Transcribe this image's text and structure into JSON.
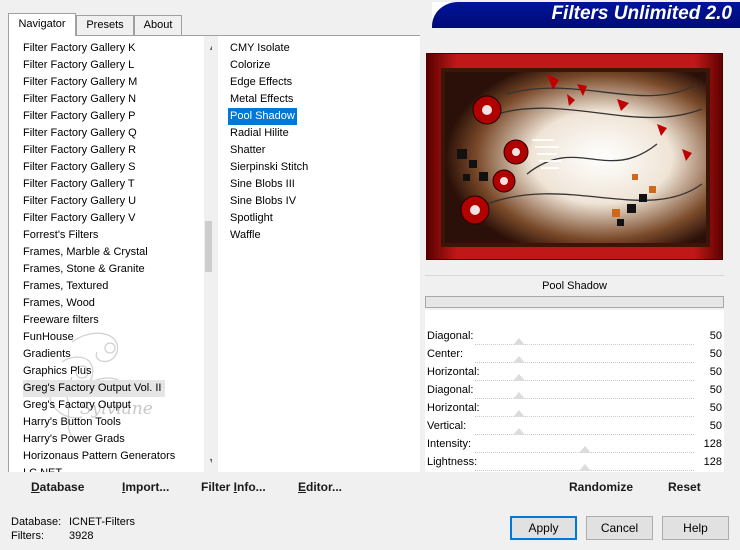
{
  "tabs": [
    "Navigator",
    "Presets",
    "About"
  ],
  "banner": {
    "title": "Filters Unlimited 2.0"
  },
  "categories": [
    "Filter Factory Gallery K",
    "Filter Factory Gallery L",
    "Filter Factory Gallery M",
    "Filter Factory Gallery N",
    "Filter Factory Gallery P",
    "Filter Factory Gallery Q",
    "Filter Factory Gallery R",
    "Filter Factory Gallery S",
    "Filter Factory Gallery T",
    "Filter Factory Gallery U",
    "Filter Factory Gallery V",
    "Forrest's Filters",
    "Frames, Marble & Crystal",
    "Frames, Stone & Granite",
    "Frames, Textured",
    "Frames, Wood",
    "Freeware filters",
    "FunHouse",
    "Gradients",
    "Graphics Plus",
    "Greg's Factory Output Vol. II",
    "Greg's Factory Output",
    "Harry's Button Tools",
    "Harry's Power Grads",
    "Horizonaus Pattern Generators",
    "I.C.NET"
  ],
  "filters": [
    "CMY Isolate",
    "Colorize",
    "Edge Effects",
    "Metal Effects",
    "Pool Shadow",
    "Radial Hilite",
    "Shatter",
    "Sierpinski Stitch",
    "Sine Blobs III",
    "Sine Blobs IV",
    "Spotlight",
    "Waffle"
  ],
  "watermark": {
    "text": "Sylviane"
  },
  "params": {
    "title": "Pool Shadow",
    "rows": [
      {
        "label": "Diagonal:",
        "value": "50",
        "level": 0.2
      },
      {
        "label": "Center:",
        "value": "50",
        "level": 0.2
      },
      {
        "label": "Horizontal:",
        "value": "50",
        "level": 0.2
      },
      {
        "label": "Diagonal:",
        "value": "50",
        "level": 0.2
      },
      {
        "label": "Horizontal:",
        "value": "50",
        "level": 0.2
      },
      {
        "label": "Vertical:",
        "value": "50",
        "level": 0.2
      },
      {
        "label": "Intensity:",
        "value": "128",
        "level": 0.5
      },
      {
        "label": "Lightness:",
        "value": "128",
        "level": 0.5
      }
    ]
  },
  "left_buttons": {
    "database": {
      "u": "D",
      "rest": "atabase"
    },
    "import": {
      "pre": "",
      "u": "I",
      "rest": "mport..."
    },
    "filter_info": {
      "pre": "Filter ",
      "u": "I",
      "rest": "nfo..."
    },
    "editor": {
      "u": "E",
      "rest": "ditor..."
    }
  },
  "right_buttons": {
    "randomize": "Randomize",
    "reset": "Reset"
  },
  "status": {
    "database_label": "Database:",
    "database_value": "ICNET-Filters",
    "filters_label": "Filters:",
    "filters_value": "3928"
  },
  "dialog_buttons": {
    "apply": "Apply",
    "cancel": "Cancel",
    "help": "Help"
  },
  "colors": {
    "selection": "#0078d7",
    "banner": "#00149a",
    "preview_frame": "#9a0c0c"
  }
}
